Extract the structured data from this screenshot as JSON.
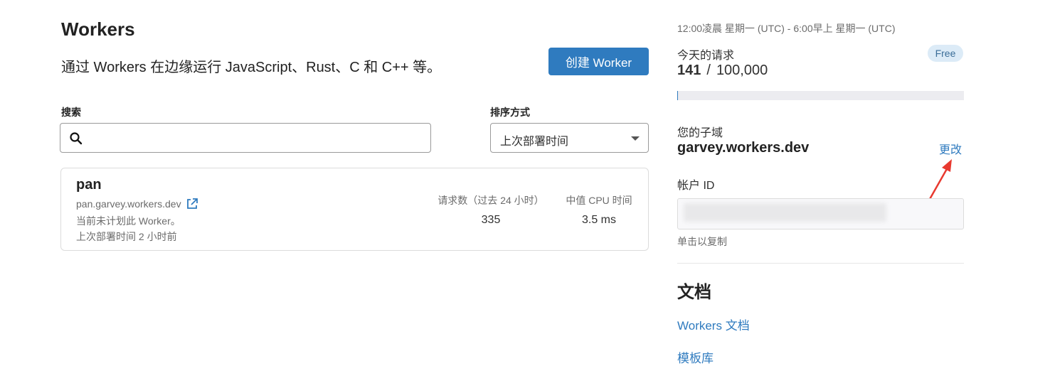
{
  "header": {
    "title": "Workers",
    "subtitle": "通过 Workers 在边缘运行 JavaScript、Rust、C 和 C++ 等。",
    "create_button": "创建 Worker"
  },
  "search": {
    "label": "搜索",
    "value": "",
    "placeholder": ""
  },
  "sort": {
    "label": "排序方式",
    "selected": "上次部署时间"
  },
  "workers": [
    {
      "name": "pan",
      "url": "pan.garvey.workers.dev",
      "schedule_note": "当前未计划此 Worker。",
      "last_deploy": "上次部署时间 2 小时前",
      "requests_label": "请求数（过去 24 小时）",
      "requests": "335",
      "cpu_label": "中值 CPU 时间",
      "cpu": "3.5 ms"
    }
  ],
  "usage": {
    "time_range": "12:00凌晨 星期一 (UTC) - 6:00早上 星期一 (UTC)",
    "today_label": "今天的请求",
    "plan_badge": "Free",
    "used": "141",
    "separator": "/",
    "limit": "100,000",
    "used_fraction": 0.00141
  },
  "subdomain": {
    "label": "您的子域",
    "value": "garvey.workers.dev",
    "change_link": "更改"
  },
  "account": {
    "label": "帐户 ID",
    "copy_hint": "单击以复制"
  },
  "docs": {
    "title": "文档",
    "links": [
      "Workers 文档",
      "模板库"
    ]
  },
  "colors": {
    "primary": "#2f7bbf",
    "annotation_arrow": "#e8392f"
  }
}
